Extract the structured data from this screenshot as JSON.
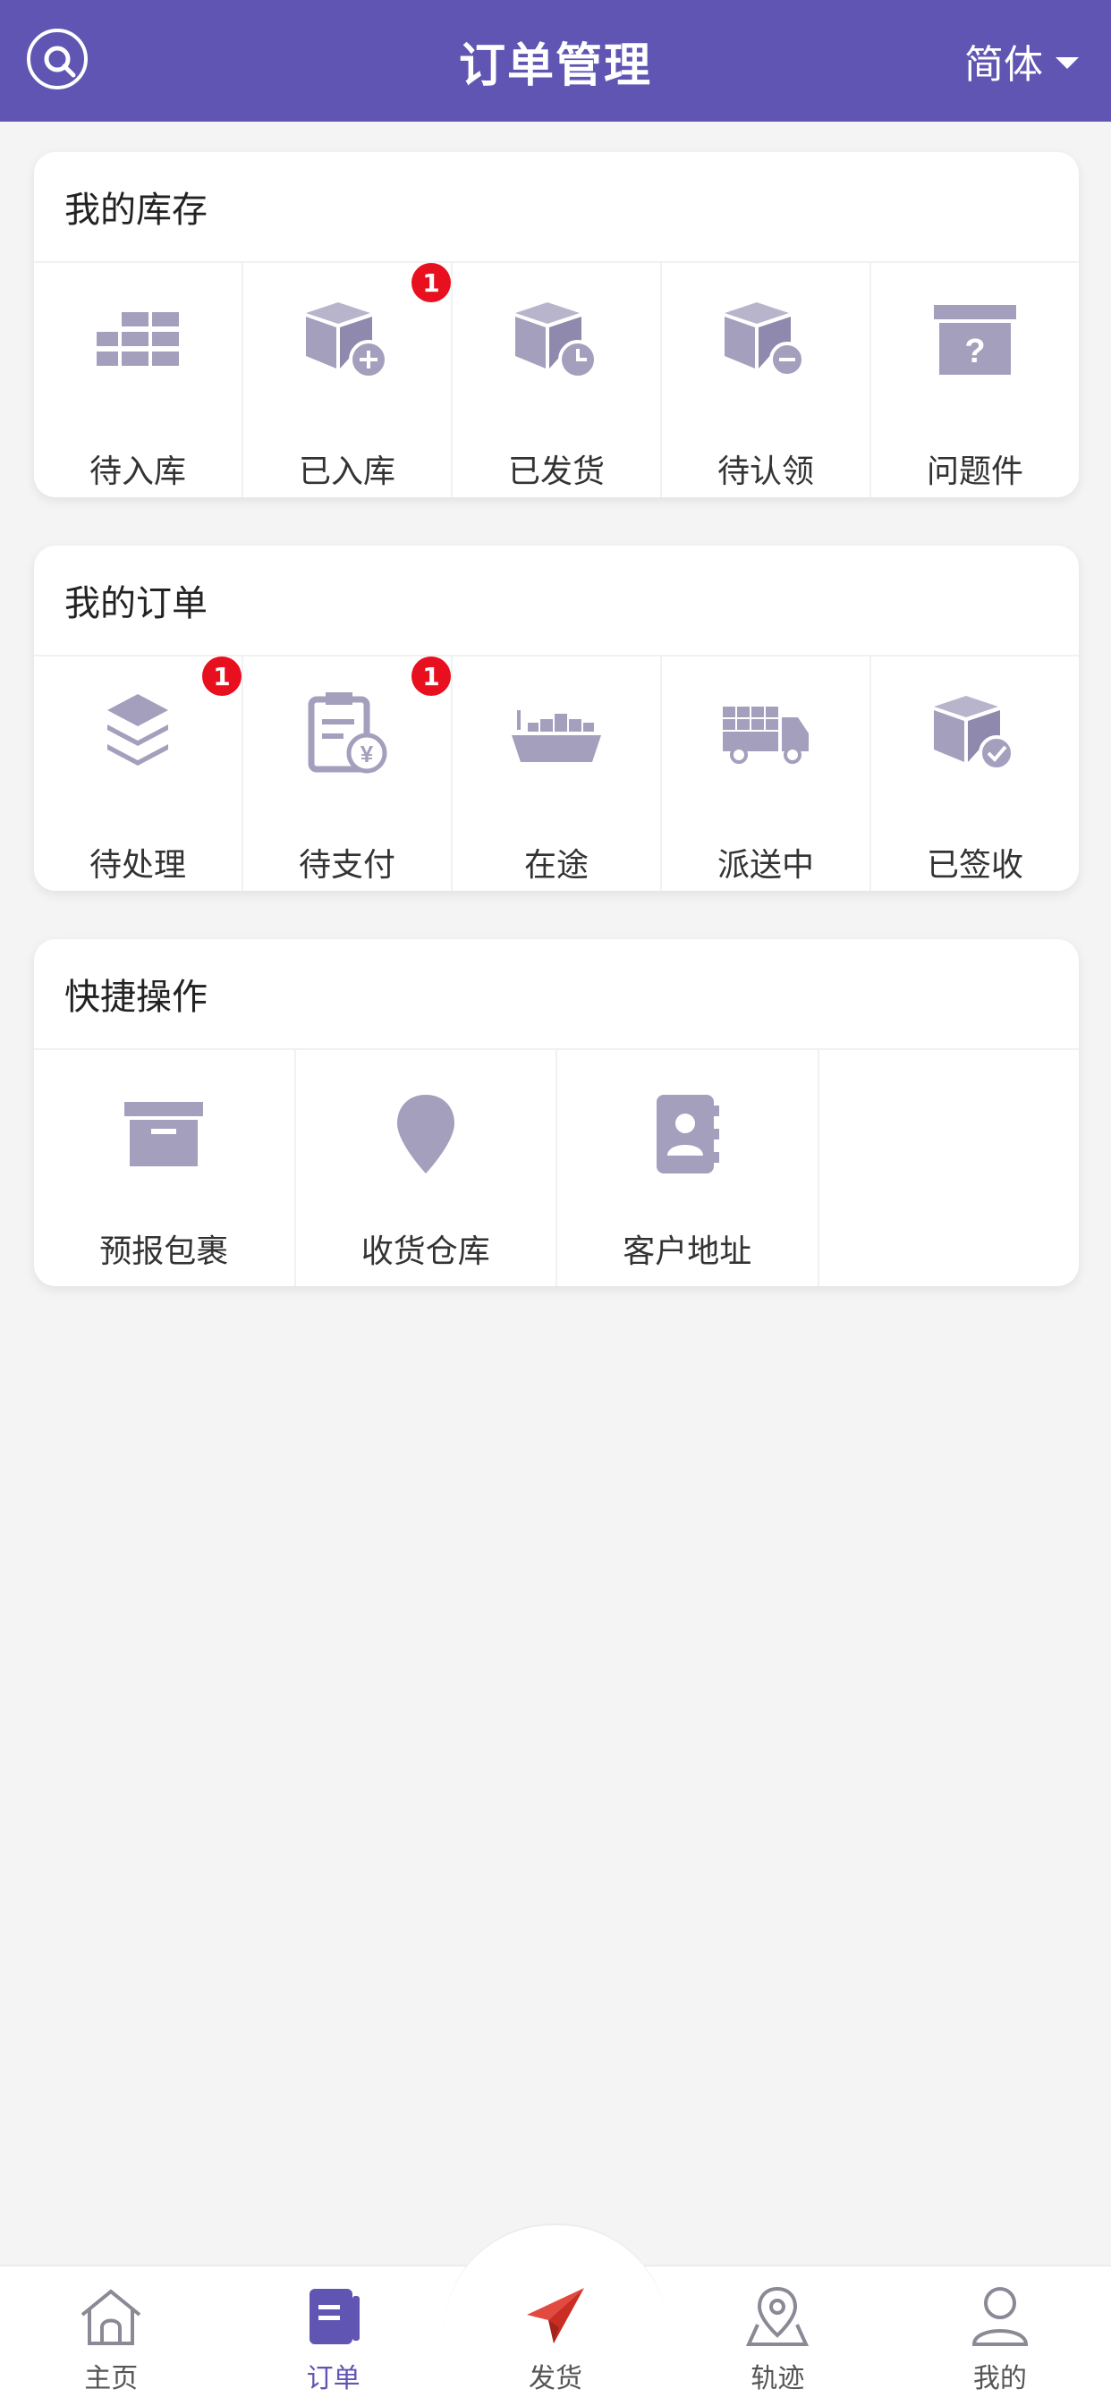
{
  "header": {
    "title": "订单管理",
    "language": "简体"
  },
  "inventory": {
    "title": "我的库存",
    "items": [
      {
        "label": "待入库",
        "icon": "bricks-icon"
      },
      {
        "label": "已入库",
        "icon": "box-plus-icon",
        "badge": "1"
      },
      {
        "label": "已发货",
        "icon": "box-clock-icon"
      },
      {
        "label": "待认领",
        "icon": "box-minus-icon"
      },
      {
        "label": "问题件",
        "icon": "box-question-icon"
      }
    ]
  },
  "orders": {
    "title": "我的订单",
    "items": [
      {
        "label": "待处理",
        "icon": "layers-icon",
        "badge": "1"
      },
      {
        "label": "待支付",
        "icon": "clipboard-yen-icon",
        "badge": "1"
      },
      {
        "label": "在途",
        "icon": "ship-icon"
      },
      {
        "label": "派送中",
        "icon": "truck-icon"
      },
      {
        "label": "已签收",
        "icon": "box-check-icon"
      }
    ]
  },
  "quick": {
    "title": "快捷操作",
    "items": [
      {
        "label": "预报包裹",
        "icon": "archive-icon"
      },
      {
        "label": "收货仓库",
        "icon": "location-pin-icon"
      },
      {
        "label": "客户地址",
        "icon": "address-book-icon"
      }
    ]
  },
  "tabbar": {
    "items": [
      {
        "label": "主页",
        "icon": "home-icon"
      },
      {
        "label": "订单",
        "icon": "order-icon",
        "active": true
      },
      {
        "label": "发货",
        "icon": "paper-plane-icon"
      },
      {
        "label": "轨迹",
        "icon": "map-pin-icon"
      },
      {
        "label": "我的",
        "icon": "user-icon"
      }
    ]
  },
  "colors": {
    "brand": "#6055b3",
    "icon": "#a49fbd",
    "badge": "#e8101f",
    "ship": "#d9372b"
  }
}
